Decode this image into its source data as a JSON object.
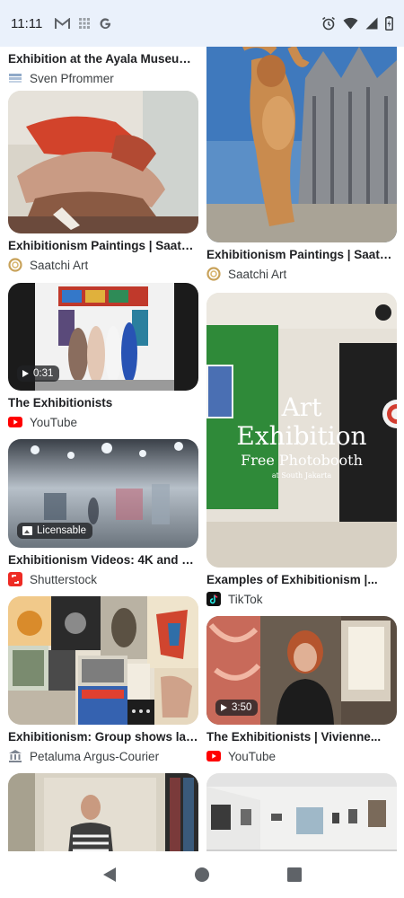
{
  "status_bar": {
    "time": "11:11",
    "left_icons": [
      "gmail-icon",
      "grid-app-icon",
      "google-g-icon"
    ],
    "right_icons": [
      "alarm-icon",
      "wifi-icon",
      "signal-icon",
      "battery-icon"
    ]
  },
  "left_column": [
    {
      "title": "Exhibition at the Ayala Museum ...",
      "source": "Sven Pfrommer",
      "source_icon": "sven-pfrommer-favicon"
    },
    {
      "title": "Exhibitionism Paintings | Saatchi...",
      "source": "Saatchi Art",
      "source_icon": "saatchi-art-favicon"
    },
    {
      "title": "The Exhibitionists",
      "source": "YouTube",
      "source_icon": "youtube-icon",
      "badge": "0:31"
    },
    {
      "title": "Exhibitionism Videos: 4K and H...",
      "source": "Shutterstock",
      "source_icon": "shutterstock-icon",
      "badge": "Licensable"
    },
    {
      "title": "Exhibitionism: Group shows larg...",
      "source": "Petaluma Argus-Courier",
      "source_icon": "museum-icon"
    }
  ],
  "right_column": [
    {
      "title": "Exhibitionism Paintings | Saatchi...",
      "source": "Saatchi Art",
      "source_icon": "saatchi-art-favicon"
    },
    {
      "title": "Examples of Exhibitionism |...",
      "source": "TikTok",
      "source_icon": "tiktok-icon",
      "image_text": {
        "line1": "Art",
        "line2": "Exhibition",
        "line3": "Free Photobooth",
        "line4": "at South Jakarta"
      }
    },
    {
      "title": "The Exhibitionists | Vivienne...",
      "source": "YouTube",
      "source_icon": "youtube-icon",
      "badge": "3:50"
    }
  ],
  "nav_bar": {
    "buttons": [
      "back-icon",
      "home-icon",
      "recents-icon"
    ]
  }
}
